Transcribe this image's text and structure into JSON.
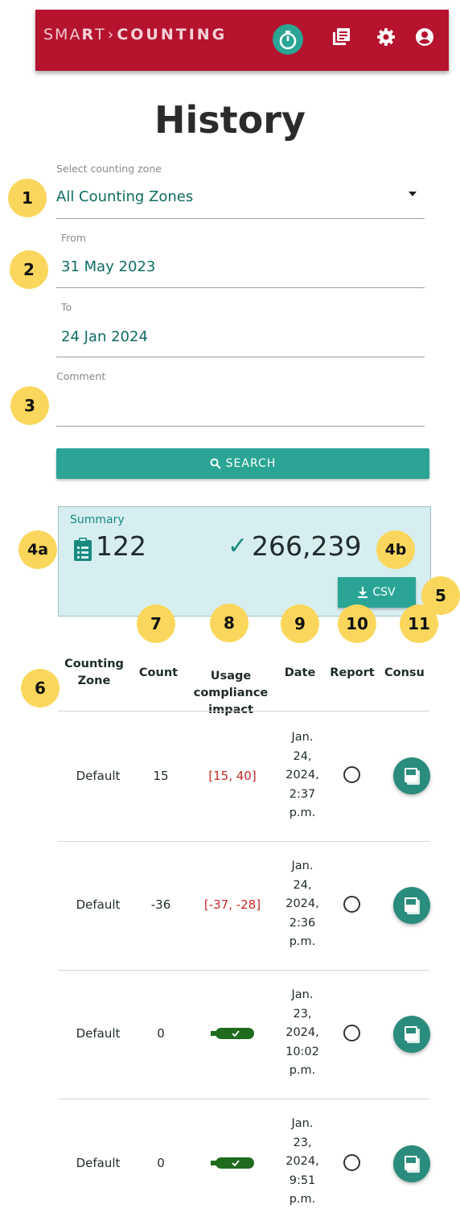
{
  "app": {
    "logo_thin": "SMA",
    "logo_r": "R",
    "logo_t": "T",
    "logo_arrow": "›",
    "logo_bold": "COUNTING",
    "icons": [
      "timer-icon",
      "history-icon",
      "settings-icon",
      "account-icon"
    ],
    "accent_color": "#b5132e",
    "teal_color": "#2aa595"
  },
  "page": {
    "title": "History"
  },
  "filters": {
    "zone_label": "Select counting zone",
    "zone_value": "All Counting Zones",
    "from_label": "From",
    "from_value": "31 May 2023",
    "to_label": "To",
    "to_value": "24 Jan 2024",
    "comment_label": "Comment",
    "comment_value": "",
    "search_label": "SEARCH"
  },
  "summary": {
    "label": "Summary",
    "count": "122",
    "compliance": "266,239",
    "csv_label": "CSV"
  },
  "badges": {
    "b1": "1",
    "b2": "2",
    "b3": "3",
    "b4a": "4a",
    "b4b": "4b",
    "b5": "5",
    "b6": "6",
    "b7": "7",
    "b8": "8",
    "b9": "9",
    "b10": "10",
    "b11": "11"
  },
  "table": {
    "headers": {
      "zone_line1": "Counting",
      "zone_line2": "Zone",
      "count": "Count",
      "impact_line1": "Usage",
      "impact_line2": "compliance",
      "impact_line3": "impact",
      "date": "Date",
      "report": "Report",
      "consult": "Consu"
    },
    "rows": [
      {
        "zone": "Default",
        "count": "15",
        "impact": "[15, 40]",
        "impact_ok": false,
        "date": [
          "Jan.",
          "24,",
          "2024,",
          "2:37",
          "p.m."
        ]
      },
      {
        "zone": "Default",
        "count": "-36",
        "impact": "[-37, -28]",
        "impact_ok": false,
        "date": [
          "Jan.",
          "24,",
          "2024,",
          "2:36",
          "p.m."
        ]
      },
      {
        "zone": "Default",
        "count": "0",
        "impact": "",
        "impact_ok": true,
        "date": [
          "Jan.",
          "23,",
          "2024,",
          "10:02",
          "p.m."
        ]
      },
      {
        "zone": "Default",
        "count": "0",
        "impact": "",
        "impact_ok": true,
        "date": [
          "Jan.",
          "23,",
          "2024,",
          "9:51",
          "p.m."
        ]
      }
    ]
  }
}
